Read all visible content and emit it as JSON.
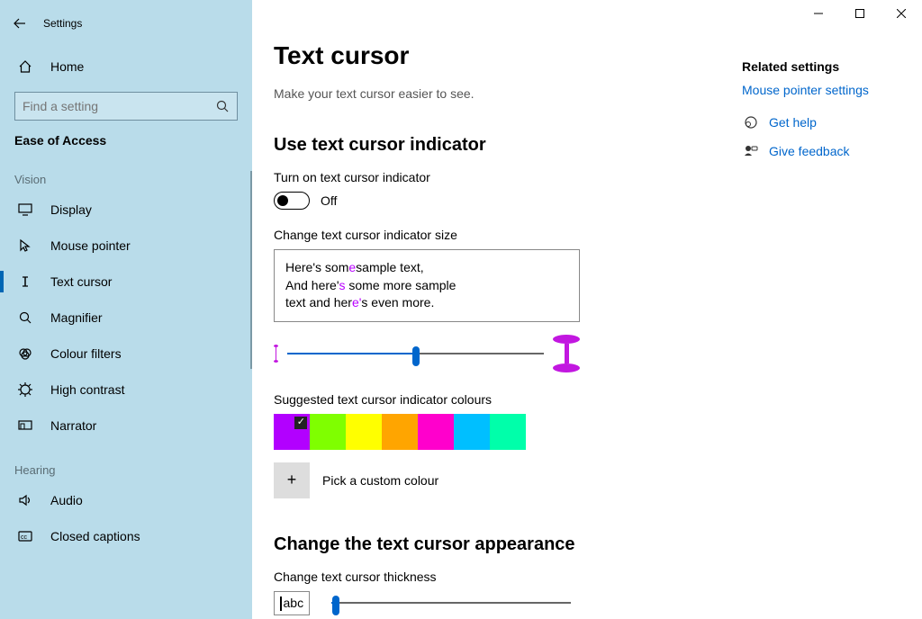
{
  "app_title": "Settings",
  "home_label": "Home",
  "search_placeholder": "Find a setting",
  "breadcrumb": "Ease of Access",
  "groups": [
    {
      "label": "Vision",
      "items": [
        {
          "key": "display",
          "label": "Display"
        },
        {
          "key": "mouse-pointer",
          "label": "Mouse pointer"
        },
        {
          "key": "text-cursor",
          "label": "Text cursor",
          "selected": true
        },
        {
          "key": "magnifier",
          "label": "Magnifier"
        },
        {
          "key": "colour-filters",
          "label": "Colour filters"
        },
        {
          "key": "high-contrast",
          "label": "High contrast"
        },
        {
          "key": "narrator",
          "label": "Narrator"
        }
      ]
    },
    {
      "label": "Hearing",
      "items": [
        {
          "key": "audio",
          "label": "Audio"
        },
        {
          "key": "closed-captions",
          "label": "Closed captions"
        }
      ]
    }
  ],
  "page": {
    "title": "Text cursor",
    "subtitle": "Make your text cursor easier to see.",
    "section1": "Use text cursor indicator",
    "toggle_label": "Turn on text cursor indicator",
    "toggle_state": "Off",
    "size_label": "Change text cursor indicator size",
    "preview_line1a": "Here's som",
    "preview_line1b": "sample text,",
    "preview_line2a": "And here'",
    "preview_line2b": " some more sample",
    "preview_line3a": "text and her",
    "preview_line3b": "s even more.",
    "colours_label": "Suggested text cursor indicator colours",
    "colours": [
      "#b200ff",
      "#7fff00",
      "#ffff00",
      "#ffa500",
      "#ff00cc",
      "#00bfff",
      "#00ffaa"
    ],
    "selected_colour_index": 0,
    "custom_colour_label": "Pick a custom colour",
    "section2": "Change the text cursor appearance",
    "thickness_label": "Change text cursor thickness",
    "abc_sample": "abc",
    "slider1_percent": 50,
    "slider2_percent": 2
  },
  "right": {
    "related_h": "Related settings",
    "related_link": "Mouse pointer settings",
    "help": "Get help",
    "feedback": "Give feedback"
  }
}
